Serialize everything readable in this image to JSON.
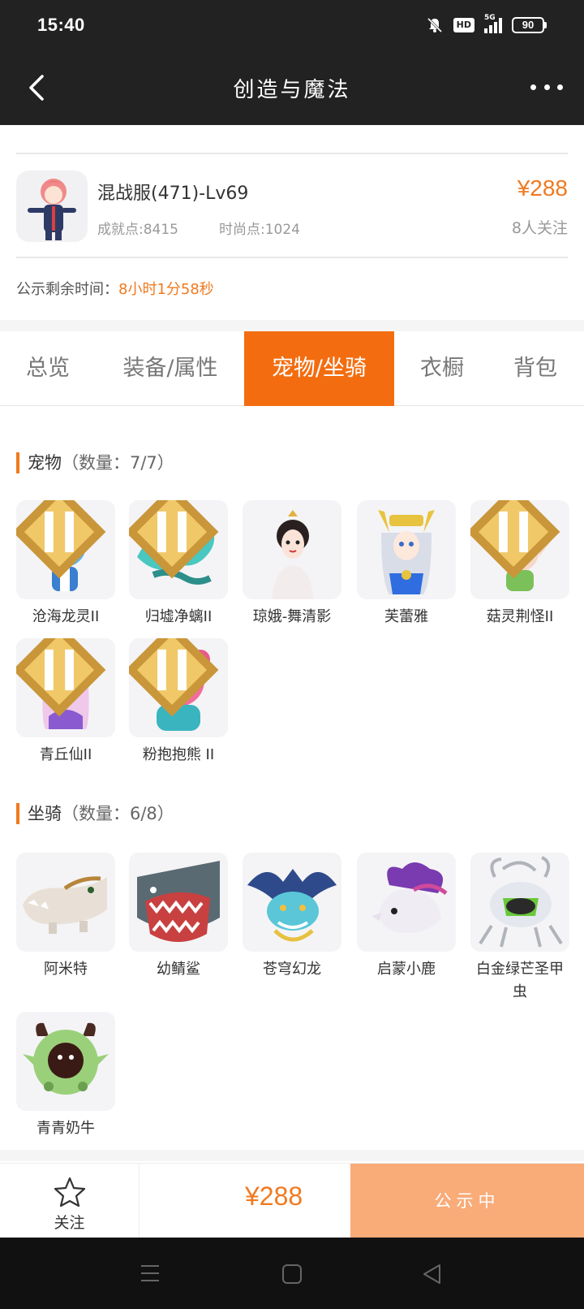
{
  "status_bar": {
    "time": "15:40",
    "hd_label": "HD",
    "network": "5G",
    "battery": "90"
  },
  "header": {
    "title": "创造与魔法"
  },
  "item": {
    "name": "混战服(471)-Lv69",
    "achievement": "成就点:8415",
    "fashion": "时尚点:1024",
    "price": "¥288",
    "followers": "8人关注"
  },
  "countdown": {
    "label": "公示剩余时间：",
    "value": "8小时1分58秒"
  },
  "tabs": [
    {
      "label": "总览"
    },
    {
      "label": "装备/属性"
    },
    {
      "label": "宠物/坐骑"
    },
    {
      "label": "衣橱"
    },
    {
      "label": "背包"
    }
  ],
  "pets": {
    "title": "宠物",
    "count": "（数量：7/7）",
    "items": [
      {
        "name": "沧海龙灵II"
      },
      {
        "name": "归墟净螭II"
      },
      {
        "name": "琼娥-舞清影"
      },
      {
        "name": "芙蕾雅"
      },
      {
        "name": "菇灵荆怪II"
      },
      {
        "name": "青丘仙II"
      },
      {
        "name": "粉抱抱熊 II"
      }
    ]
  },
  "mounts": {
    "title": "坐骑",
    "count": "（数量：6/8）",
    "items": [
      {
        "name": "阿米特"
      },
      {
        "name": "幼鲭鲨"
      },
      {
        "name": "苍穹幻龙"
      },
      {
        "name": "启蒙小鹿"
      },
      {
        "name": "白金绿芒圣甲虫"
      },
      {
        "name": "青青奶牛"
      }
    ]
  },
  "bottom": {
    "follow_label": "关注",
    "price": "¥288",
    "status_button": "公示中"
  },
  "colors": {
    "accent": "#f36d10",
    "price": "#f07a20",
    "publish_bg": "#f9ab78",
    "header_bg": "#222222"
  }
}
